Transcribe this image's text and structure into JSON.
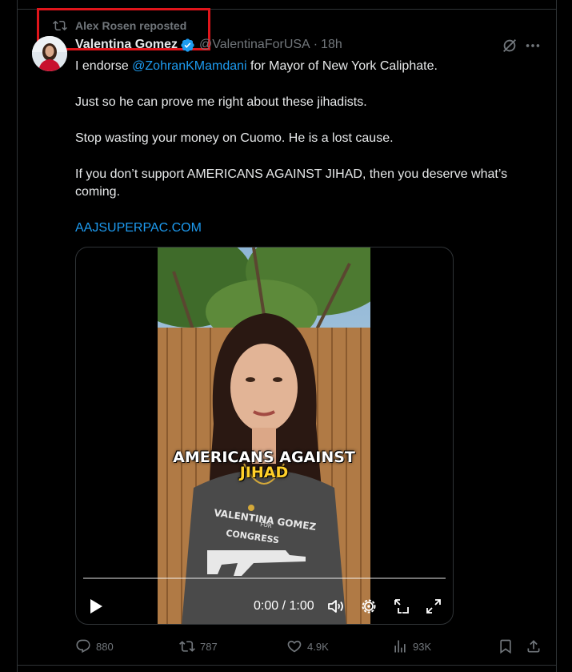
{
  "repost": {
    "text": "Alex Rosen reposted"
  },
  "author": {
    "name": "Valentina Gomez",
    "handle": "@ValentinaForUSA",
    "separator": "·",
    "time": "18h"
  },
  "tweet": {
    "line1_pre": "I endorse ",
    "line1_mention": "@ZohranKMamdani",
    "line1_post": " for Mayor of New York Caliphate.",
    "line2": "Just so he can prove me right about these jihadists.",
    "line3": "Stop wasting your money on Cuomo. He is a lost cause.",
    "line4": "If you don’t support AMERICANS AGAINST JIHAD, then you deserve what’s coming.",
    "link": "AAJSUPERPAC.COM"
  },
  "video": {
    "caption_line1": "AMERICANS AGAINST",
    "caption_line2": "JIHAD",
    "shirt_line1": "VALENTINA GOMEZ",
    "shirt_line2": "FOR",
    "shirt_line3": "CONGRESS",
    "current_time": "0:00",
    "duration": "1:00",
    "time_display": "0:00 / 1:00",
    "progress": 0
  },
  "actions": {
    "replies": "880",
    "reposts": "787",
    "likes": "4.9K",
    "views": "93K"
  },
  "colors": {
    "accent": "#1d9bf0",
    "highlight": "#e0151b",
    "muted": "#71767b",
    "caption_yellow": "#ffd02a"
  }
}
